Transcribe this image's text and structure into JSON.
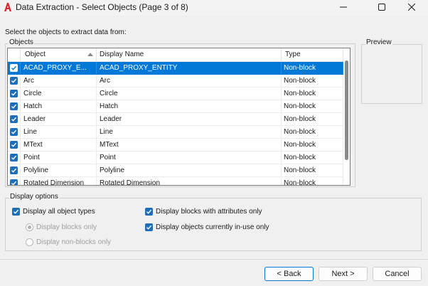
{
  "window": {
    "title": "Data Extraction - Select Objects (Page 3 of 8)"
  },
  "instruction": "Select the objects to extract data from:",
  "objects_group": {
    "caption": "Objects",
    "columns": [
      "Object",
      "Display Name",
      "Type"
    ],
    "sorted_column": "Object",
    "rows": [
      {
        "object": "ACAD_PROXY_E...",
        "display_name": "ACAD_PROXY_ENTITY",
        "type": "Non-block",
        "checked": true,
        "selected": true
      },
      {
        "object": "Arc",
        "display_name": "Arc",
        "type": "Non-block",
        "checked": true,
        "selected": false
      },
      {
        "object": "Circle",
        "display_name": "Circle",
        "type": "Non-block",
        "checked": true,
        "selected": false
      },
      {
        "object": "Hatch",
        "display_name": "Hatch",
        "type": "Non-block",
        "checked": true,
        "selected": false
      },
      {
        "object": "Leader",
        "display_name": "Leader",
        "type": "Non-block",
        "checked": true,
        "selected": false
      },
      {
        "object": "Line",
        "display_name": "Line",
        "type": "Non-block",
        "checked": true,
        "selected": false
      },
      {
        "object": "MText",
        "display_name": "MText",
        "type": "Non-block",
        "checked": true,
        "selected": false
      },
      {
        "object": "Point",
        "display_name": "Point",
        "type": "Non-block",
        "checked": true,
        "selected": false
      },
      {
        "object": "Polyline",
        "display_name": "Polyline",
        "type": "Non-block",
        "checked": true,
        "selected": false
      },
      {
        "object": "Rotated Dimension",
        "display_name": "Rotated Dimension",
        "type": "Non-block",
        "checked": true,
        "selected": false
      }
    ]
  },
  "preview_group": {
    "caption": "Preview"
  },
  "display_options": {
    "caption": "Display options",
    "display_all_types": {
      "label": "Display all object types",
      "checked": true
    },
    "blocks_only": {
      "label": "Display blocks only",
      "selected": true,
      "enabled": false
    },
    "non_blocks_only": {
      "label": "Display non-blocks only",
      "selected": false,
      "enabled": false
    },
    "blocks_with_attributes": {
      "label": "Display blocks with attributes only",
      "checked": true
    },
    "objects_in_use": {
      "label": "Display objects currently in-use only",
      "checked": true
    }
  },
  "buttons": {
    "back": "< Back",
    "next": "Next >",
    "cancel": "Cancel"
  },
  "colors": {
    "accent": "#0078d7",
    "checkbox": "#1f6fb8",
    "app_icon": "#d7262c"
  },
  "icons": {
    "app": "autocad-logo-icon",
    "minimize": "minimize-icon",
    "maximize": "maximize-icon",
    "close": "close-icon",
    "checkmark": "checkmark-icon"
  }
}
